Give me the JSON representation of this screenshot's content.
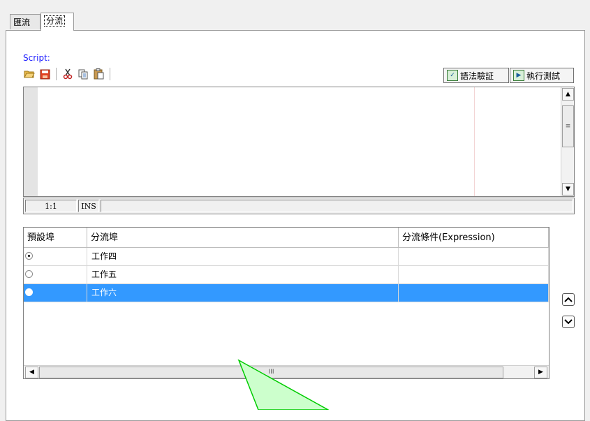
{
  "tabs": [
    {
      "label": "匯流",
      "active": false
    },
    {
      "label": "分流",
      "active": true
    }
  ],
  "script": {
    "label": "Script:",
    "toolbar_icons": [
      "open-folder-icon",
      "save-icon",
      "cut-icon",
      "copy-icon",
      "paste-icon"
    ],
    "validate_button": "語法驗証",
    "test_button": "執行測試",
    "editor_content": ""
  },
  "status": {
    "position": "1:1",
    "mode": "INS",
    "message": ""
  },
  "grid": {
    "columns": [
      "預設埠",
      "分流埠",
      "分流條件(Expression)"
    ],
    "rows": [
      {
        "default": true,
        "port": "工作四",
        "expression": "",
        "selected": false
      },
      {
        "default": false,
        "port": "工作五",
        "expression": "",
        "selected": false
      },
      {
        "default": false,
        "port": "工作六",
        "expression": "",
        "selected": true
      }
    ],
    "hscroll_label": "III"
  },
  "colors": {
    "accent": "#1a1aff",
    "selection": "#3399ff",
    "annotation": "#ccffcc"
  }
}
